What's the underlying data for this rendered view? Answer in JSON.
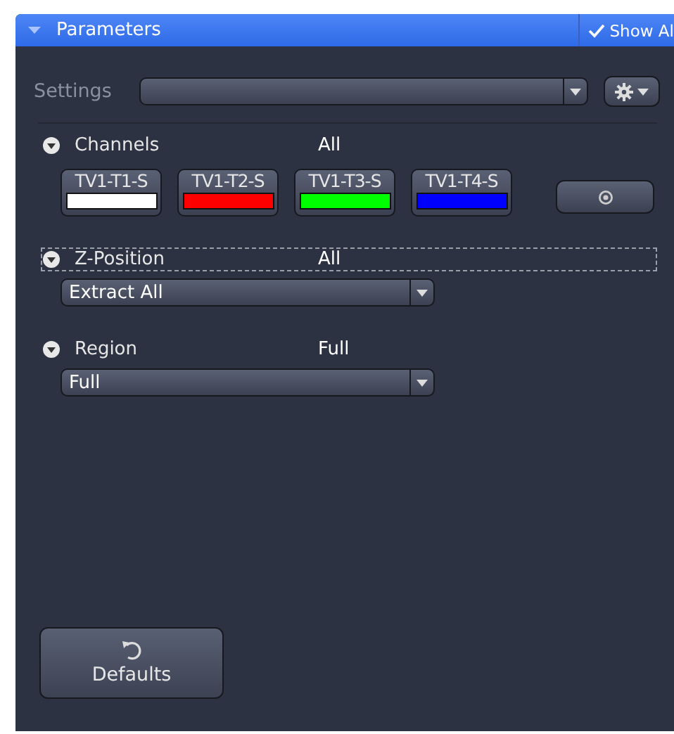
{
  "panel": {
    "title": "Parameters",
    "expanded": true,
    "show_all": {
      "label": "Show Al",
      "checked": true
    }
  },
  "settings": {
    "label": "Settings"
  },
  "sections": [
    {
      "kind": "channels",
      "title": "Channels",
      "value": "All",
      "expanded": true,
      "focused": false,
      "channels": [
        {
          "label": "TV1-T1-S",
          "color": "#ffffff"
        },
        {
          "label": "TV1-T2-S",
          "color": "#ff0000"
        },
        {
          "label": "TV1-T3-S",
          "color": "#00ff00"
        },
        {
          "label": "TV1-T4-S",
          "color": "#0000ff"
        }
      ]
    },
    {
      "kind": "dropdown",
      "title": "Z-Position",
      "value": "All",
      "expanded": true,
      "focused": true,
      "selection": "Extract All"
    },
    {
      "kind": "dropdown",
      "title": "Region",
      "value": "Full",
      "expanded": true,
      "focused": false,
      "selection": "Full"
    }
  ],
  "defaults_button": {
    "label": "Defaults"
  }
}
